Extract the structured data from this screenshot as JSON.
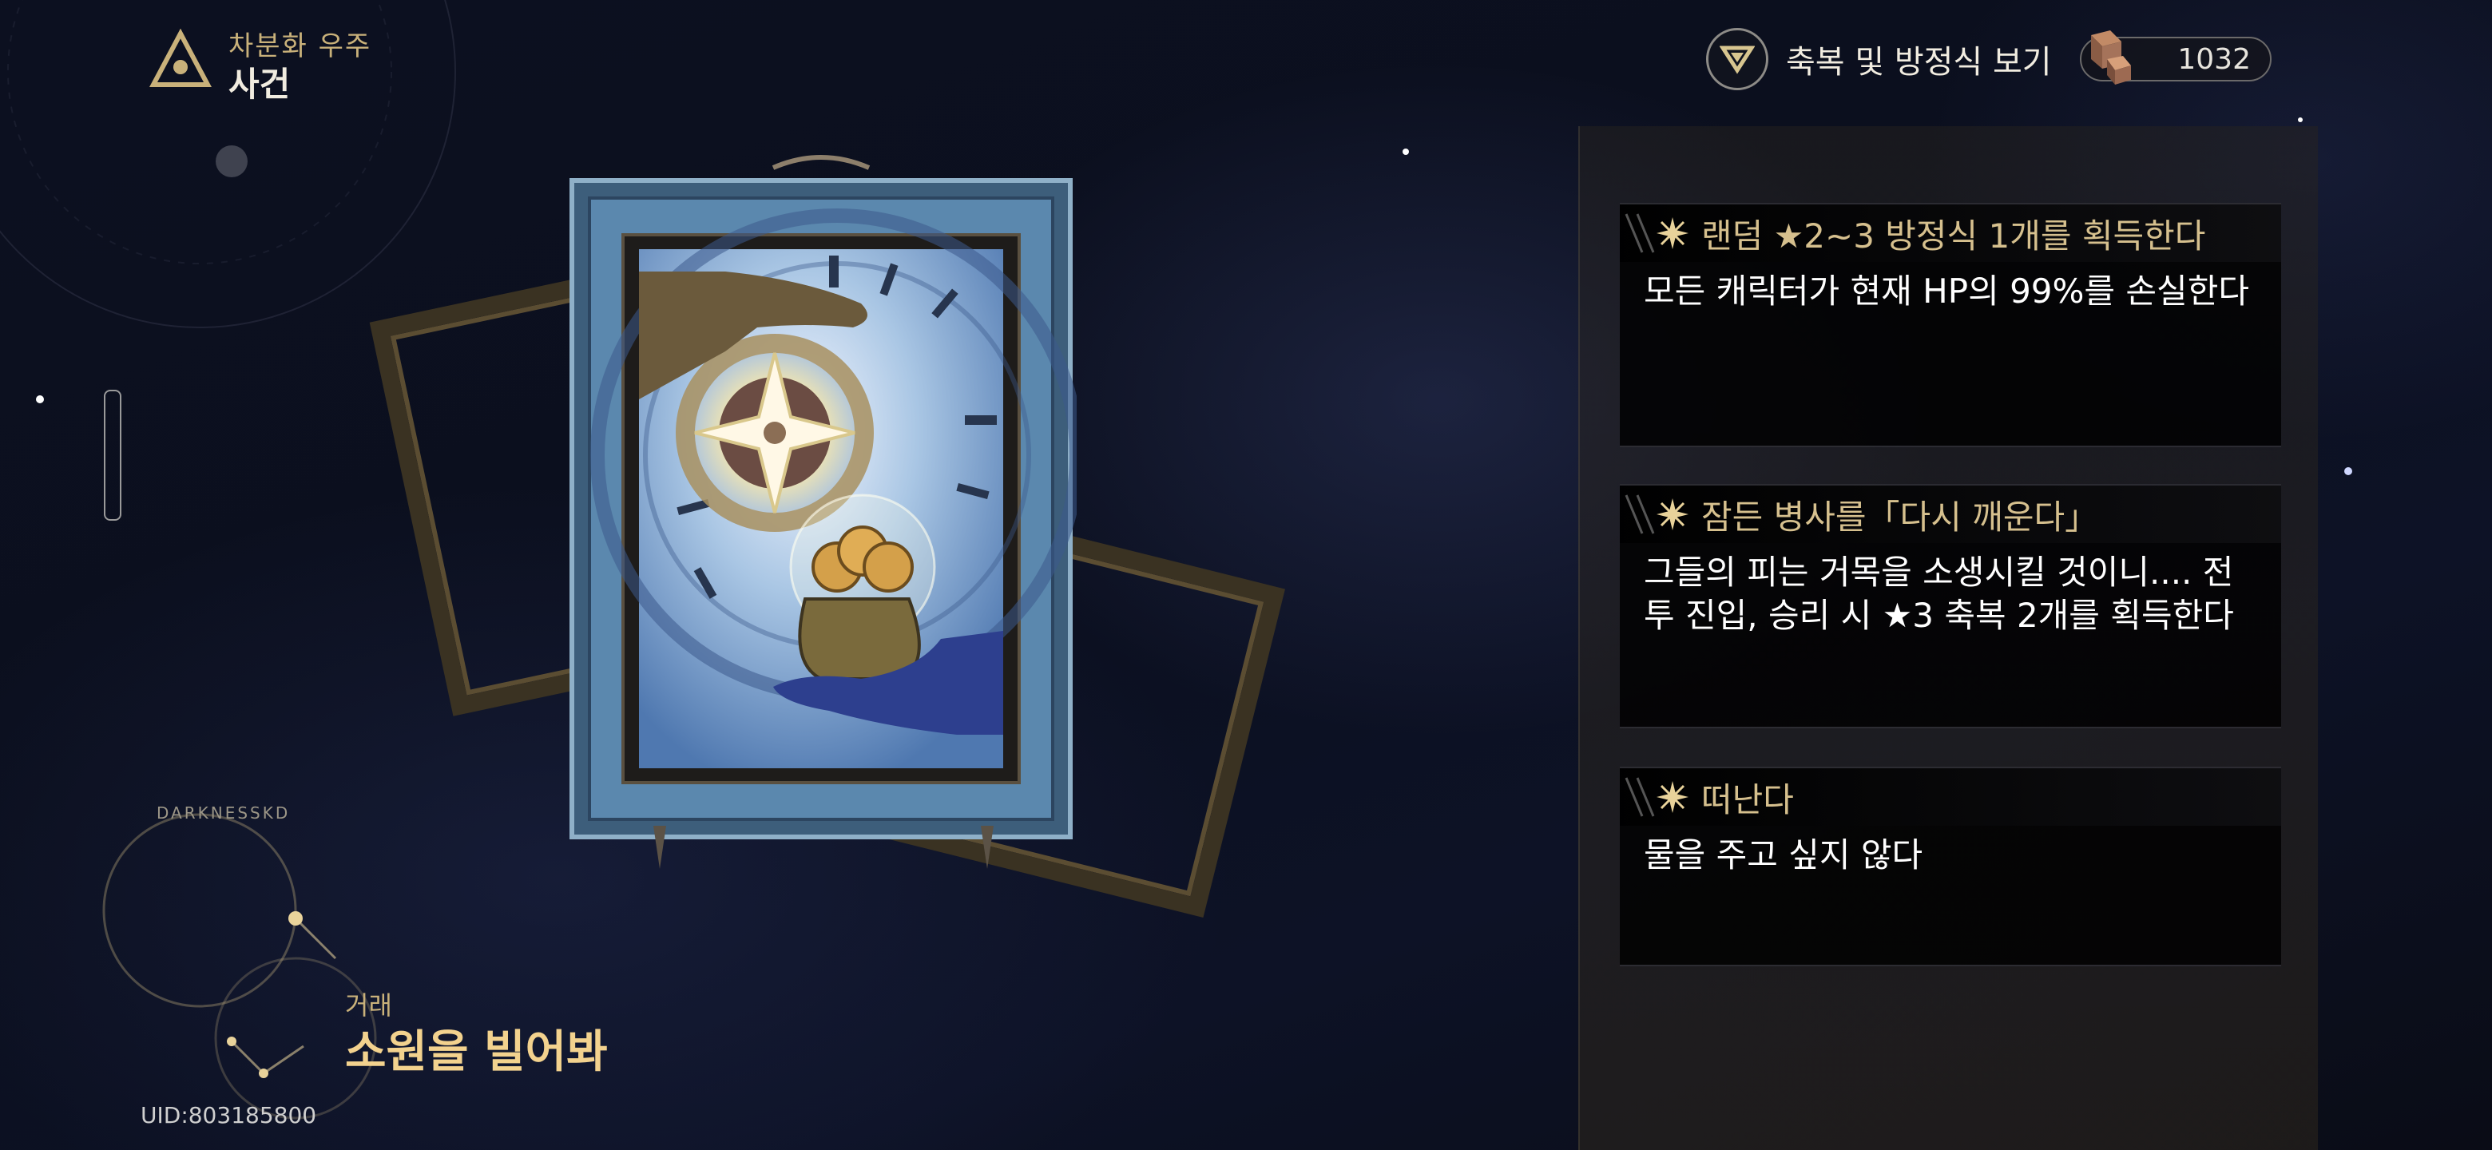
{
  "header": {
    "location_sub": "차분화 우주",
    "location_title": "사건",
    "location_icon": "triangle-emblem-icon"
  },
  "top_right": {
    "view_label": "축복 및 방정식 보기",
    "view_icon": "chevron-down-triangle-icon",
    "currency_value": "1032",
    "currency_icon": "cube-currency-icon"
  },
  "event": {
    "category": "거래",
    "name": "소원을 빌어봐",
    "constellation_label": "DARKNESSKD",
    "card_icon": "tarot-card-compass-coins-icon"
  },
  "choices": [
    {
      "title": "랜덤 ★2~3 방정식 1개를 획득한다",
      "desc": "모든 캐릭터가 현재 HP의 99%를 손실한다"
    },
    {
      "title": "잠든 병사를「다시 깨운다」",
      "desc": "그들의 피는 거목을 소생시킬 것이니.... 전투 진입, 승리 시 ★3 축복 2개를 획득한다"
    },
    {
      "title": "떠난다",
      "desc": "물을 주고 싶지 않다"
    }
  ],
  "footer": {
    "uid": "UID:803185800"
  },
  "colors": {
    "gold_text": "#d6c08e",
    "title_gold": "#f3d28e",
    "panel_black": "#000000",
    "card_blue": "#5b8ab0"
  }
}
